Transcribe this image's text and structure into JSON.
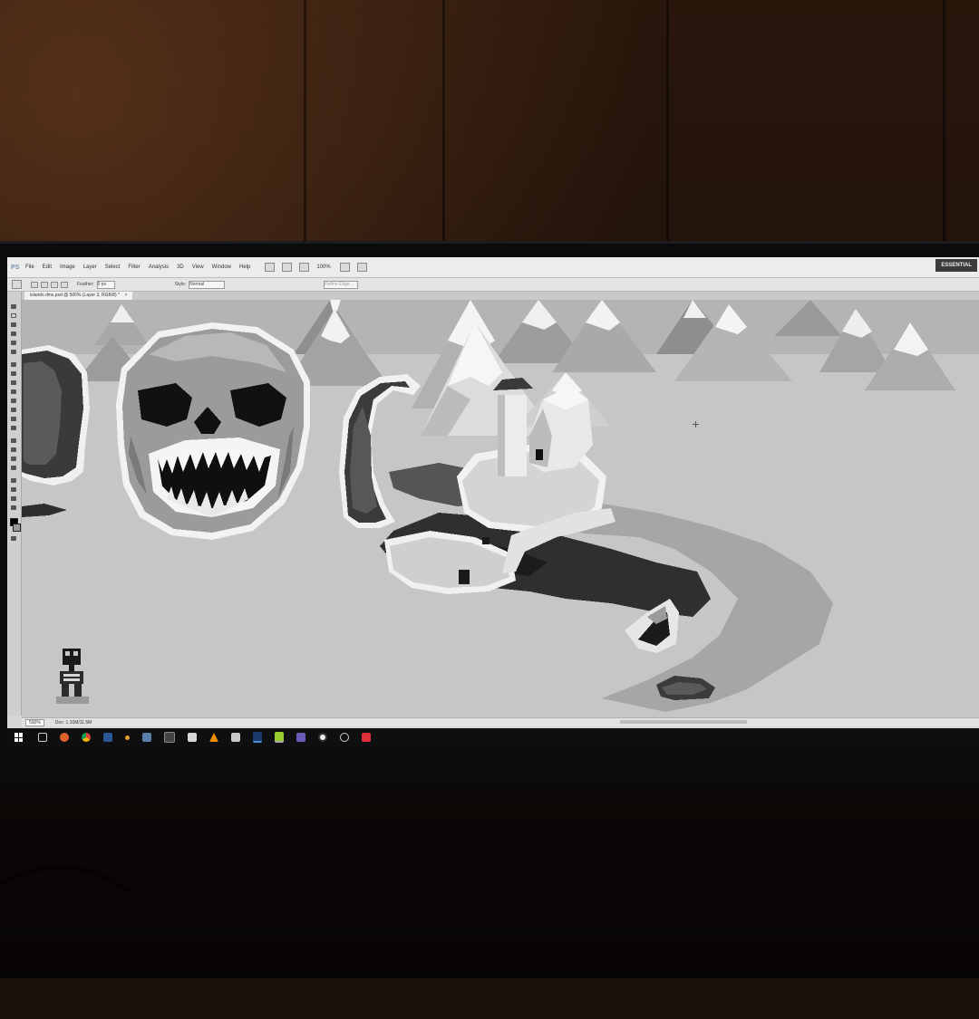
{
  "app": {
    "logo_text": "PS",
    "menu": [
      "File",
      "Edit",
      "Image",
      "Layer",
      "Select",
      "Filter",
      "Analysis",
      "3D",
      "View",
      "Window",
      "Help"
    ],
    "zoom_select": "100%",
    "workspace_button": "ESSENTIAL"
  },
  "options_bar": {
    "feather_label": "Feather:",
    "feather_value": "0 px",
    "style_label": "Style:",
    "style_value": "Normal",
    "refine_edge": "Refine Edge..."
  },
  "document": {
    "tab_title": "islands dms.psd @ 500% (Layer 3, RGB/8) *",
    "tab_close": "×"
  },
  "status": {
    "zoom": "500%",
    "doc_info": "Doc: 1.10M/11.5M"
  },
  "canvas_art": {
    "subject": "pixel-art island with giant skull, tentacles, snowy mountains, castle, shipwreck and skeleton",
    "palette": {
      "sea": "#c6c6c6",
      "snow": "#f4f4f4",
      "mountain_light": "#d9d9d9",
      "mountain_mid": "#a8a8a8",
      "mountain_dark": "#7e7e7e",
      "ink": "#111111",
      "dark_gray": "#3c3c3c",
      "shadow_water": "#9c9c9c"
    }
  },
  "taskbar": {
    "icons": [
      "windows-start-icon",
      "task-view-icon",
      "firefox-icon",
      "chrome-icon",
      "word-icon",
      "pointer-app-icon",
      "screenshot-icon",
      "excel-icon",
      "paint-icon",
      "vlc-icon",
      "explorer-icon",
      "photoshop-icon",
      "notepad-icon",
      "visual-studio-icon",
      "obs-icon",
      "clock-icon",
      "red-app-icon"
    ]
  }
}
